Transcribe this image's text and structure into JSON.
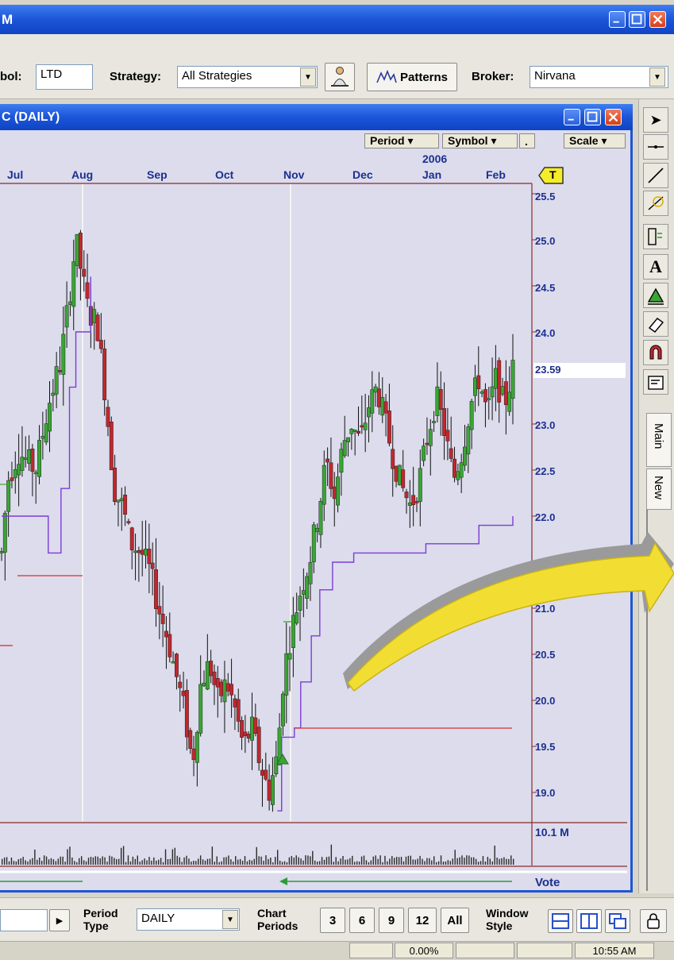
{
  "app": {
    "title_fragment": "M",
    "title_controls": [
      "minimize",
      "maximize",
      "close"
    ]
  },
  "toolbar": {
    "symbol_label": "bol:",
    "symbol_value": "LTD",
    "strategy_label": "Strategy:",
    "strategy_value": "All Strategies",
    "patterns_label": "Patterns",
    "broker_label": "Broker:",
    "broker_value": "Nirvana"
  },
  "chart_window": {
    "title": "C (DAILY)",
    "menus": {
      "period": "Period ▾",
      "symbol": "Symbol ▾",
      "dot": ".",
      "scale": "Scale ▾"
    },
    "year_label": "2006",
    "months": [
      "Jul",
      "Aug",
      "Sep",
      "Oct",
      "Nov",
      "Dec",
      "Jan",
      "Feb"
    ],
    "t_badge": "T",
    "last_price": "23.59",
    "volume_label": "10.1 M",
    "vote_label": "Vote",
    "side_tabs": [
      "Main",
      "New"
    ]
  },
  "tools": [
    "pointer-icon",
    "horizontal-line-icon",
    "trendline-icon",
    "fibonacci-icon",
    "gann-icon",
    "text-icon",
    "triangle-icon",
    "eraser-icon",
    "magnet-icon",
    "properties-icon"
  ],
  "bottom": {
    "period_type_label": "Period Type",
    "period_type_value": "DAILY",
    "chart_periods_label": "Chart Periods",
    "periods": [
      "3",
      "6",
      "9",
      "12",
      "All"
    ],
    "window_style_label": "Window Style"
  },
  "status": {
    "percent": "0.00%",
    "time": "10:55 AM"
  },
  "colors": {
    "title_blue": "#1c55d8",
    "chart_bg": "#dcdcec",
    "up_candle": "#3aa535",
    "down_candle": "#c0282f",
    "stop_line": "#7c3cd6",
    "annotation_arrow": "#f2de32"
  },
  "chart_data": {
    "type": "candlestick",
    "x": [
      "Jul",
      "Aug",
      "Sep",
      "Oct",
      "Nov",
      "Dec",
      "Jan",
      "Feb"
    ],
    "y_ticks": [
      25.5,
      25.0,
      24.5,
      24.0,
      23.0,
      22.5,
      22.0,
      21.0,
      20.5,
      20.0,
      19.5,
      19.0
    ],
    "ylim": [
      18.7,
      25.6
    ],
    "last_price": 23.59,
    "close_path": [
      [
        0,
        21.6
      ],
      [
        0.3,
        22.4
      ],
      [
        0.8,
        22.7
      ],
      [
        1.6,
        22.5
      ],
      [
        2.2,
        23.2
      ],
      [
        2.8,
        23.7
      ],
      [
        3.2,
        24.4
      ],
      [
        3.5,
        25.0
      ],
      [
        3.8,
        24.6
      ],
      [
        4.1,
        24.2
      ],
      [
        4.5,
        24.1
      ],
      [
        4.9,
        23.3
      ],
      [
        5.3,
        22.3
      ],
      [
        5.7,
        22.1
      ],
      [
        6.1,
        21.7
      ],
      [
        6.6,
        21.6
      ],
      [
        7.0,
        21.4
      ],
      [
        7.4,
        21.0
      ],
      [
        7.8,
        20.7
      ],
      [
        8.2,
        20.3
      ],
      [
        8.6,
        19.9
      ],
      [
        9.0,
        19.3
      ],
      [
        9.4,
        20.2
      ],
      [
        9.8,
        20.4
      ],
      [
        10.2,
        20.0
      ],
      [
        10.6,
        20.2
      ],
      [
        11.0,
        19.9
      ],
      [
        11.4,
        19.5
      ],
      [
        11.8,
        19.7
      ],
      [
        12.2,
        19.3
      ],
      [
        12.6,
        19.0
      ],
      [
        13.0,
        19.4
      ],
      [
        13.3,
        20.3
      ],
      [
        13.7,
        20.8
      ],
      [
        14.1,
        21.2
      ],
      [
        14.5,
        21.5
      ],
      [
        14.9,
        22.0
      ],
      [
        15.3,
        22.6
      ],
      [
        15.7,
        22.2
      ],
      [
        16.1,
        22.8
      ],
      [
        16.5,
        23.0
      ],
      [
        16.9,
        22.8
      ],
      [
        17.3,
        23.2
      ],
      [
        17.7,
        23.4
      ],
      [
        18.1,
        23.0
      ],
      [
        18.5,
        22.6
      ],
      [
        18.9,
        22.3
      ],
      [
        19.3,
        22.1
      ],
      [
        19.7,
        22.4
      ],
      [
        20.1,
        22.9
      ],
      [
        20.5,
        23.3
      ],
      [
        20.9,
        22.9
      ],
      [
        21.3,
        22.4
      ],
      [
        21.7,
        22.7
      ],
      [
        22.1,
        23.2
      ],
      [
        22.5,
        23.5
      ],
      [
        22.9,
        23.1
      ],
      [
        23.3,
        23.5
      ],
      [
        23.7,
        23.2
      ],
      [
        24.1,
        23.59
      ]
    ]
  }
}
